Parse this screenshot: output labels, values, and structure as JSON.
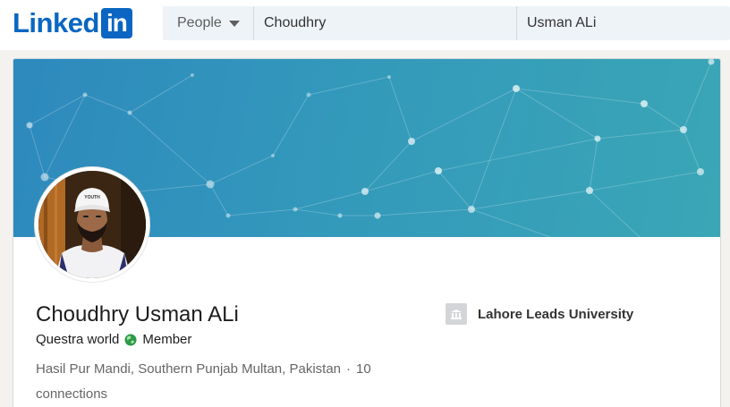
{
  "header": {
    "logo_text": "Linked",
    "logo_box_text": "in",
    "brand_color": "#0a66c2",
    "search_scope": "People",
    "search_first_value": "Choudhry",
    "search_last_value": "Usman ALi"
  },
  "profile": {
    "name": "Choudhry Usman ALi",
    "headline_company": "Questra world",
    "headline_role": "Member",
    "location": "Hasil Pur Mandi, Southern Punjab Multan, Pakistan",
    "separator": "·",
    "connections": "10 connections",
    "school": "Lahore Leads University",
    "avatar_cap_text": "YOUTH"
  },
  "icons": {
    "scope_dropdown": "chevron-down-icon",
    "headline_globe": "globe-icon",
    "school_logo": "school-icon"
  },
  "colors": {
    "banner_start": "#2e89bd",
    "banner_end": "#3aa6b6",
    "accent": "#0a66c2"
  }
}
